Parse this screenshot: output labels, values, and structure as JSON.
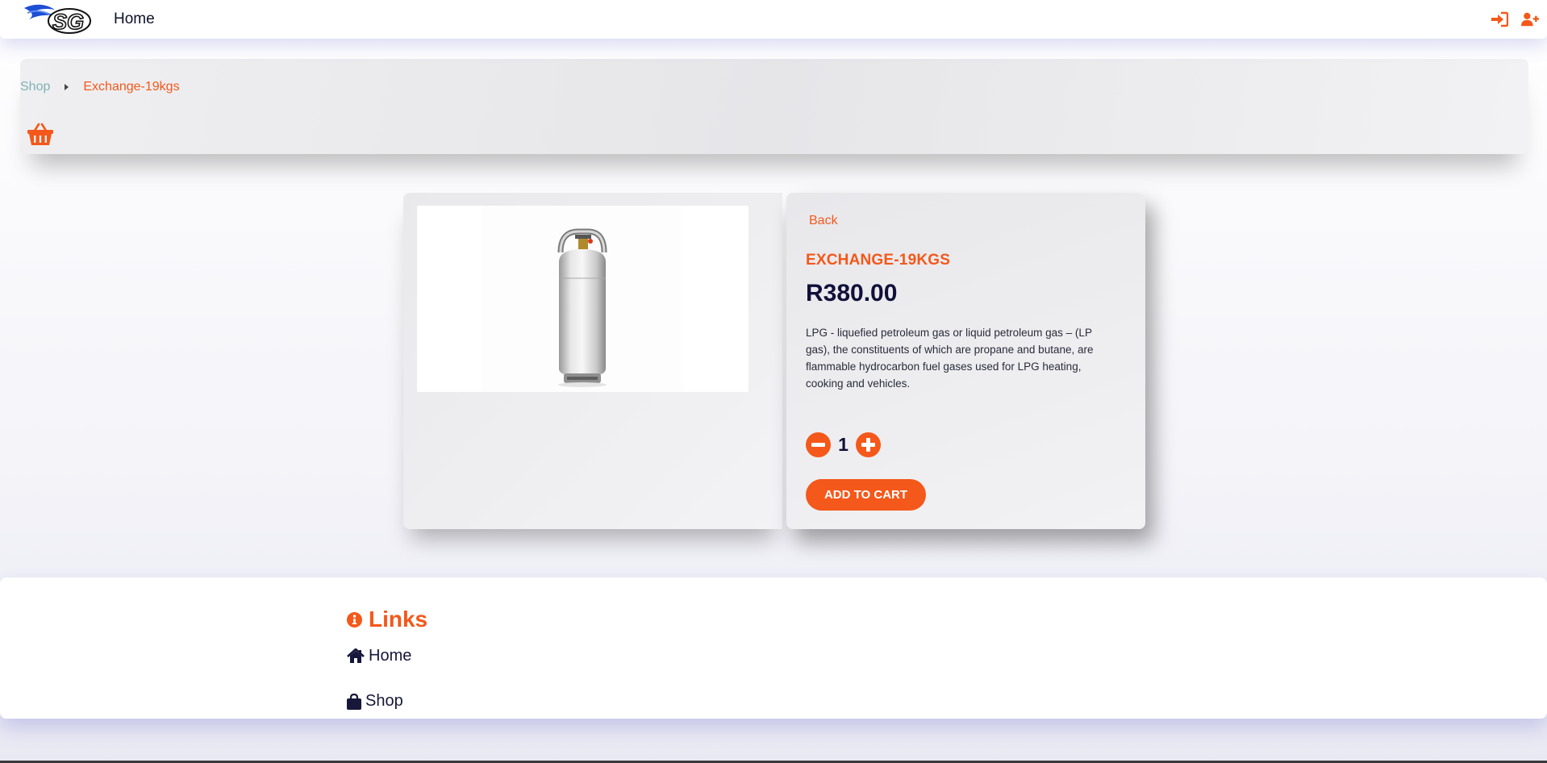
{
  "navbar": {
    "logo_text": "SG",
    "home_label": "Home",
    "icons": [
      "sign-in-icon",
      "user-plus-icon"
    ]
  },
  "breadcrumb": {
    "shop_label": "Shop",
    "current_label": "Exchange-19kgs"
  },
  "product": {
    "back_label": "Back",
    "title": "EXCHANGE-19KGS",
    "price": "R380.00",
    "description": "LPG - liquefied petroleum gas or liquid petroleum gas – (LP gas), the constituents of which are propane and butane, are flammable hydrocarbon fuel gases used for LPG heating, cooking and vehicles.",
    "quantity": "1",
    "add_to_cart_label": "ADD TO CART"
  },
  "footer": {
    "heading": "Links",
    "links": [
      {
        "label": "Home",
        "icon": "home-icon"
      },
      {
        "label": "Shop",
        "icon": "shopping-bag-icon"
      }
    ]
  },
  "colors": {
    "accent": "#f4581a",
    "dark_text": "#10103a",
    "breadcrumb_link": "#7fb2b4"
  }
}
